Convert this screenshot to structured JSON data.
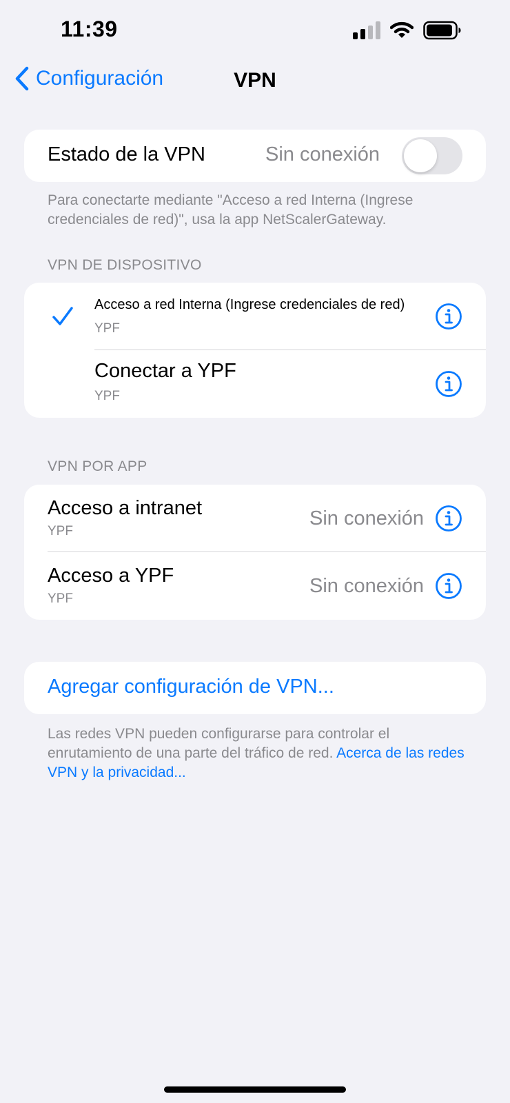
{
  "status_bar": {
    "time": "11:39"
  },
  "nav": {
    "back_label": "Configuración",
    "title": "VPN"
  },
  "vpn_status": {
    "label": "Estado de la VPN",
    "value": "Sin conexión",
    "toggle_on": false,
    "footer": "Para conectarte mediante \"Acceso a red Interna (Ingrese credenciales de red)\", usa la app NetScalerGateway."
  },
  "device_vpn": {
    "header": "VPN DE DISPOSITIVO",
    "items": [
      {
        "title": "Acceso a red Interna (Ingrese credenciales de red)",
        "subtitle": "YPF",
        "selected": true
      },
      {
        "title": "Conectar a YPF",
        "subtitle": "YPF",
        "selected": false
      }
    ]
  },
  "app_vpn": {
    "header": "VPN POR APP",
    "items": [
      {
        "title": "Acceso a intranet",
        "subtitle": "YPF",
        "status": "Sin conexión"
      },
      {
        "title": "Acceso a YPF",
        "subtitle": "YPF",
        "status": "Sin conexión"
      }
    ]
  },
  "add_vpn": {
    "label": "Agregar configuración de VPN...",
    "footer_text": "Las redes VPN pueden configurarse para controlar el enrutamiento de una parte del tráfico de red. ",
    "footer_link": "Acerca de las redes VPN y la privacidad..."
  },
  "colors": {
    "accent": "#0A7AFF",
    "background": "#F2F2F7",
    "secondary_text": "#8A8A8E"
  },
  "icons": [
    "cellular-signal-icon",
    "wifi-icon",
    "battery-icon",
    "chevron-left-icon",
    "checkmark-icon",
    "info-icon"
  ]
}
